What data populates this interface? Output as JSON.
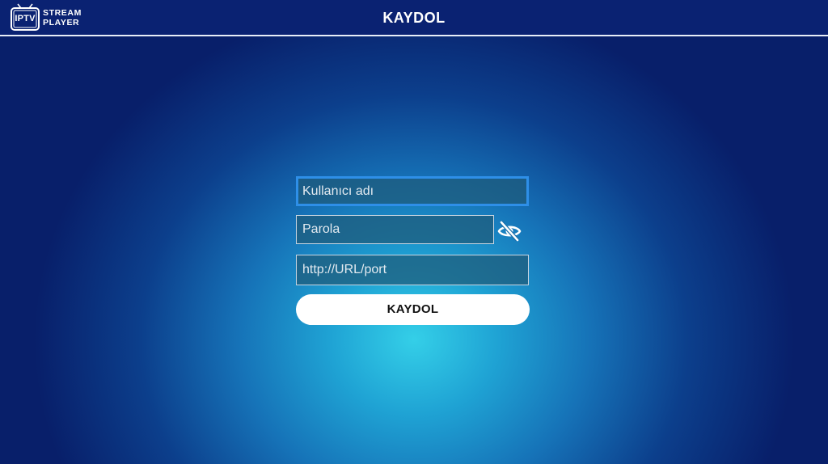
{
  "header": {
    "logo_tv_text": "IPTV",
    "brand_line1": "STREAM",
    "brand_line2": "PLAYER",
    "title": "KAYDOL"
  },
  "form": {
    "username": {
      "value": "",
      "placeholder": "Kullanıcı adı",
      "focused": true
    },
    "password": {
      "value": "",
      "placeholder": "Parola"
    },
    "url": {
      "value": "",
      "placeholder": "http://URL/port"
    },
    "submit_label": "KAYDOL"
  },
  "icons": {
    "logo": "tv-icon",
    "password_toggle": "eye-slash-icon"
  },
  "colors": {
    "header_bg": "#0a2272",
    "accent_focus": "#2e8fe8",
    "gradient_center": "#34cfe8",
    "gradient_edge": "#081f6a"
  }
}
